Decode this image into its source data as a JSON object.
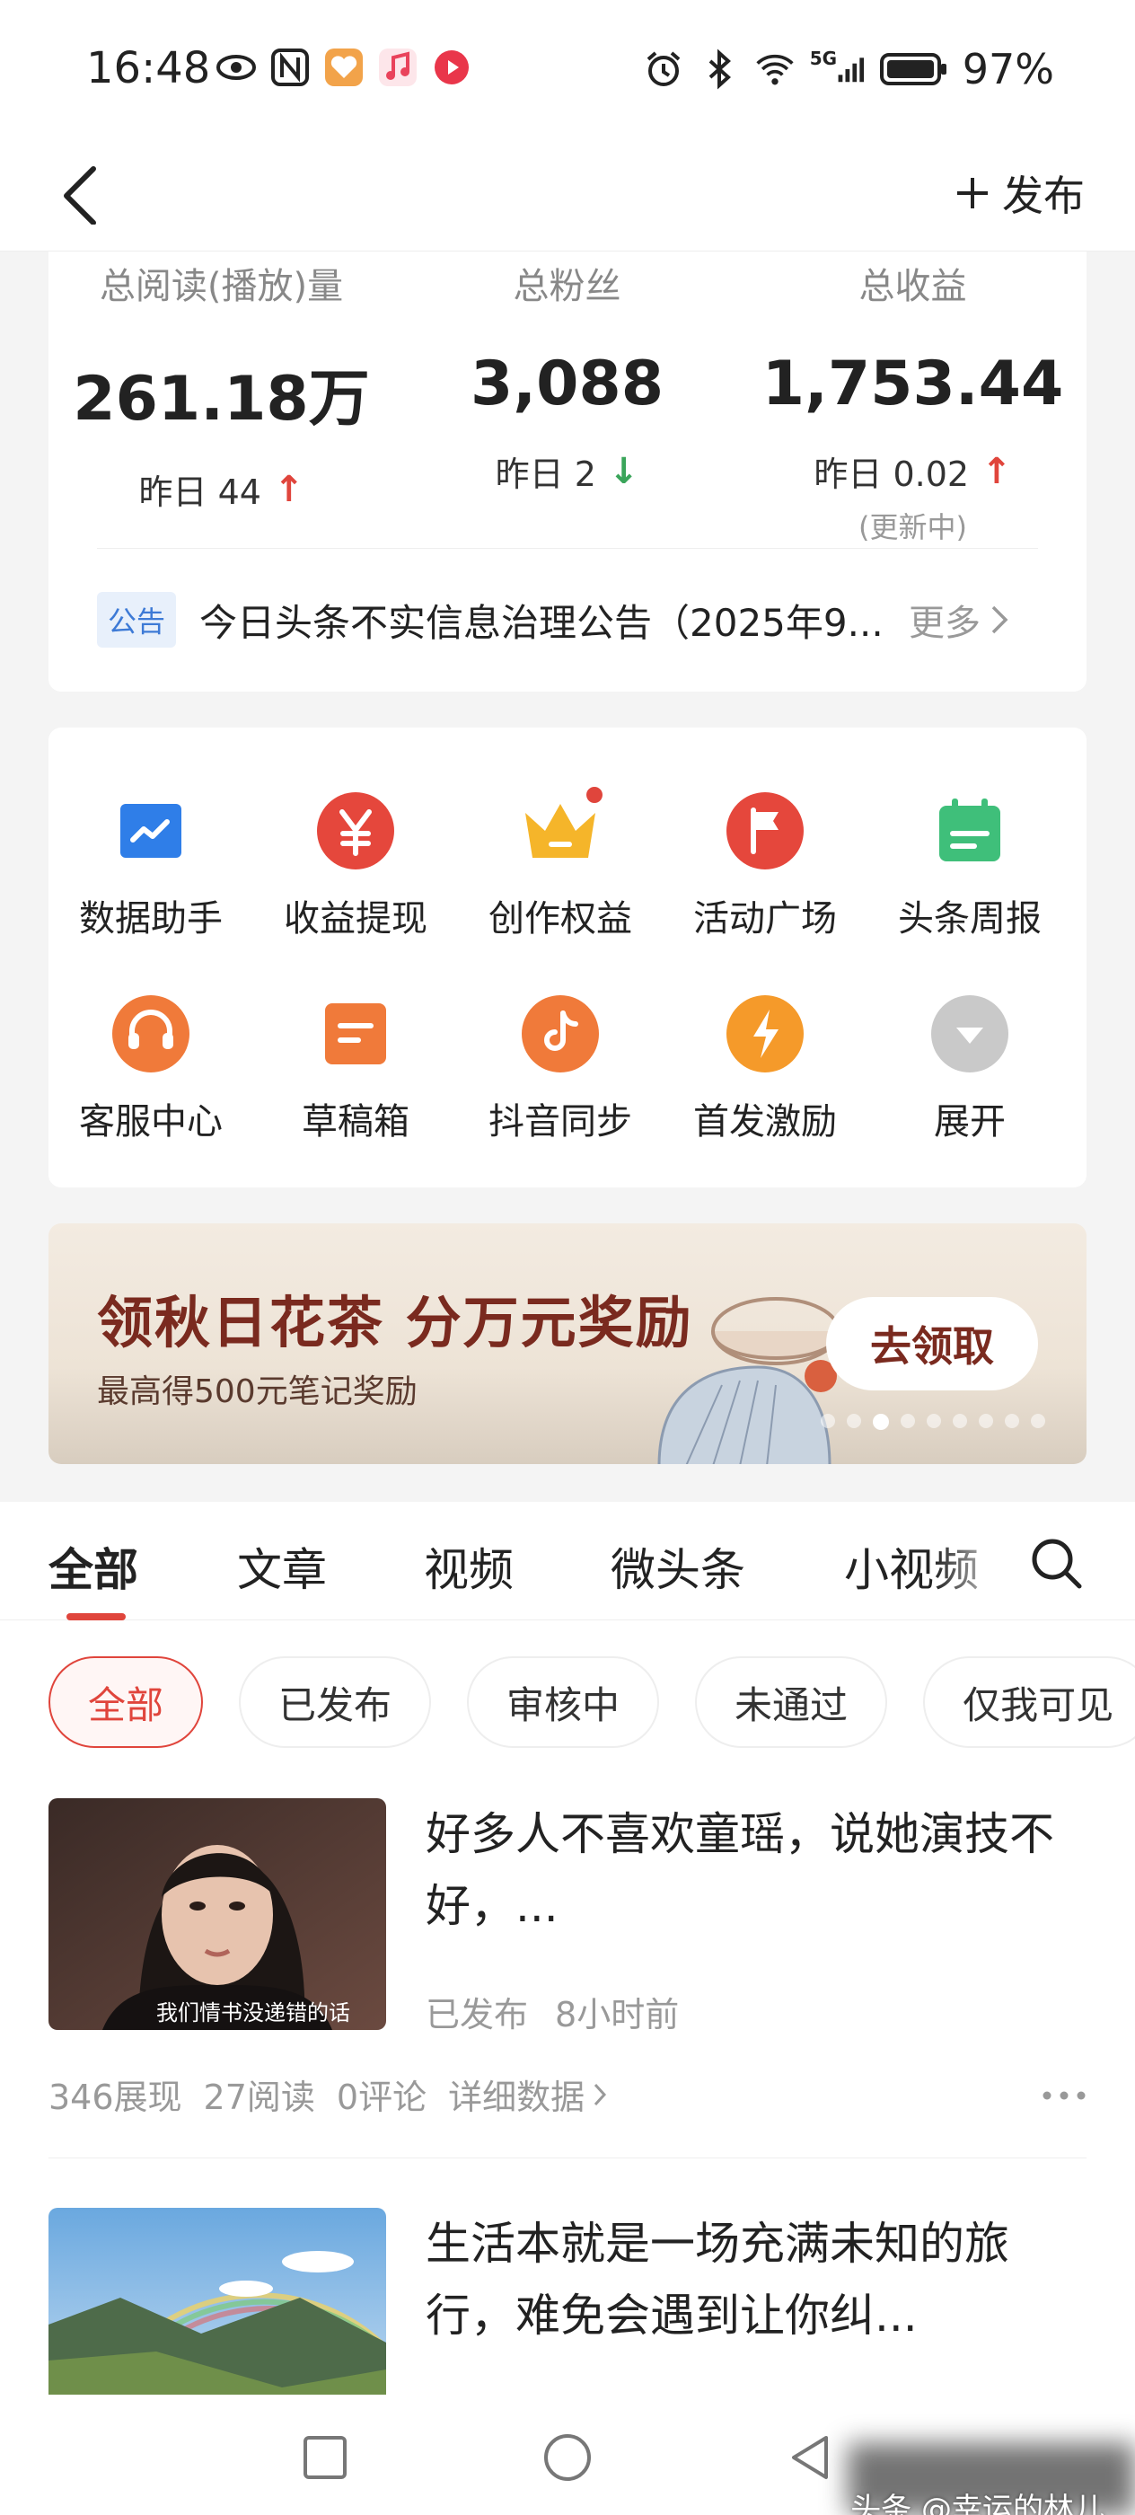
{
  "status_bar": {
    "time": "16:48",
    "battery": "97%",
    "network": "5G",
    "icons_left": [
      "eye-icon",
      "nfc-icon",
      "health-app-icon",
      "music-app-icon",
      "video-app-icon"
    ],
    "icons_right": [
      "alarm-icon",
      "bluetooth-icon",
      "wifi-icon",
      "signal-icon",
      "battery-icon"
    ]
  },
  "header": {
    "back_icon": "chevron-left-icon",
    "publish_label": "发布"
  },
  "stats": [
    {
      "label": "总阅读(播放)量",
      "value": "261.18万",
      "delta": "昨日 44",
      "trend": "up",
      "note": ""
    },
    {
      "label": "总粉丝",
      "value": "3,088",
      "delta": "昨日 2",
      "trend": "down",
      "note": ""
    },
    {
      "label": "总收益",
      "value": "1,753.44",
      "delta": "昨日 0.02",
      "trend": "up",
      "note": "(更新中)"
    }
  ],
  "notice": {
    "tag": "公告",
    "text": "今日头条不实信息治理公告（2025年9...",
    "more": "更多"
  },
  "tools": [
    {
      "label": "数据助手",
      "icon": "chart-icon",
      "color": "#2f7ee8"
    },
    {
      "label": "收益提现",
      "icon": "yuan-icon",
      "color": "#e5473c"
    },
    {
      "label": "创作权益",
      "icon": "crown-icon",
      "color": "#f5b52a"
    },
    {
      "label": "活动广场",
      "icon": "flag-icon",
      "color": "#e5473c"
    },
    {
      "label": "头条周报",
      "icon": "calendar-icon",
      "color": "#3fbf7a"
    },
    {
      "label": "客服中心",
      "icon": "headset-icon",
      "color": "#f07a3a"
    },
    {
      "label": "草稿箱",
      "icon": "draft-icon",
      "color": "#f07a3a"
    },
    {
      "label": "抖音同步",
      "icon": "tiktok-icon",
      "color": "#f07a3a"
    },
    {
      "label": "首发激励",
      "icon": "lightning-icon",
      "color": "#f59a2a"
    },
    {
      "label": "展开",
      "icon": "expand-icon",
      "color": "#c9c9c9"
    }
  ],
  "banner": {
    "title": "领秋日花茶 分万元奖励",
    "subtitle": "最高得500元笔记奖励",
    "button": "去领取",
    "dots": 9,
    "active_dot": 2
  },
  "tabs": [
    "全部",
    "文章",
    "视频",
    "微头条",
    "小视频"
  ],
  "chips": [
    "全部",
    "已发布",
    "审核中",
    "未通过",
    "仅我可见"
  ],
  "articles": [
    {
      "title": "好多人不喜欢童瑶，说她演技不好，...",
      "status": "已发布",
      "time": "8小时前",
      "stats": [
        "346展现",
        "27阅读",
        "0评论"
      ],
      "detail": "详细数据",
      "thumb_caption": "我们情书没递错的话"
    },
    {
      "title": "生活本就是一场充满未知的旅行，难免会遇到让你纠...",
      "status": "",
      "time": "",
      "stats": [],
      "detail": "",
      "thumb_caption": ""
    }
  ],
  "watermark": "头条 @幸运的林儿"
}
